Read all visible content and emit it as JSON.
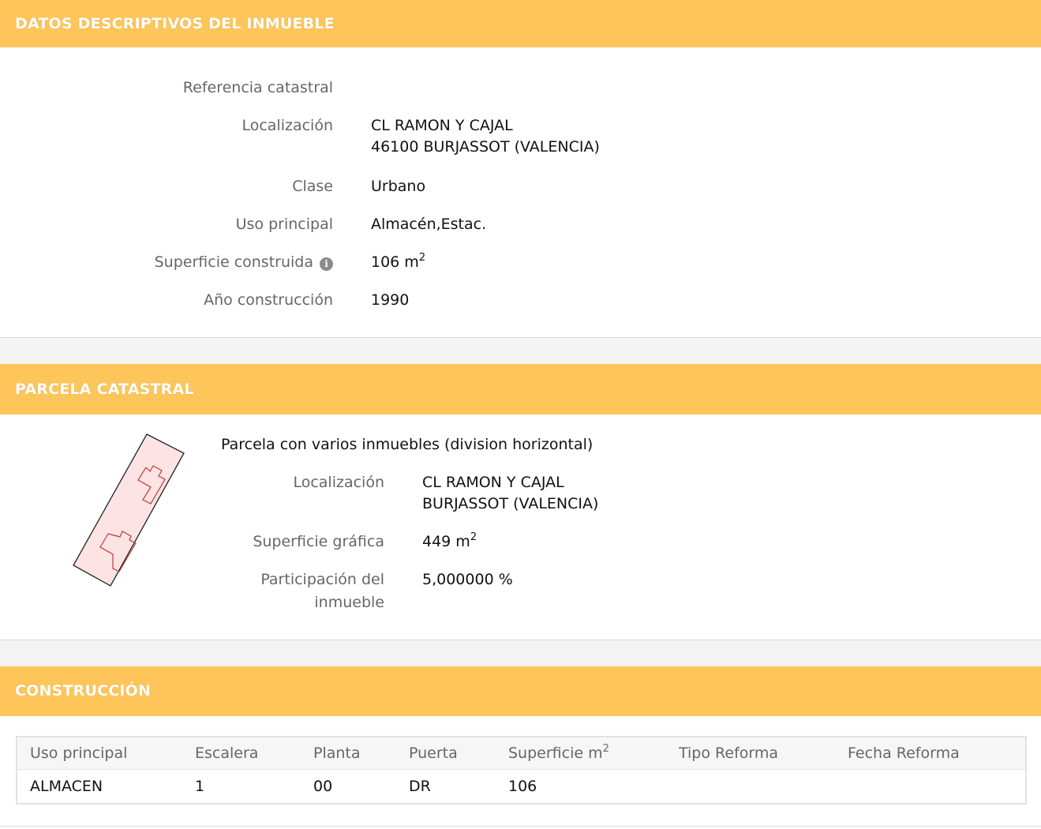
{
  "sections": {
    "descriptivos": {
      "title": "DATOS DESCRIPTIVOS DEL INMUEBLE"
    },
    "parcela": {
      "title": "PARCELA CATASTRAL"
    },
    "construccion": {
      "title": "CONSTRUCCIÓN"
    }
  },
  "inmueble": {
    "referencia_label": "Referencia catastral",
    "referencia_value": "",
    "localizacion_label": "Localización",
    "localizacion_line1": "CL RAMON Y CAJAL",
    "localizacion_line2": "46100 BURJASSOT (VALENCIA)",
    "clase_label": "Clase",
    "clase_value": "Urbano",
    "uso_label": "Uso principal",
    "uso_value": "Almacén,Estac.",
    "superficie_label": "Superficie construida",
    "superficie_value": "106 m",
    "superficie_unit_exp": "2",
    "anio_label": "Año construcción",
    "anio_value": "1990",
    "info_icon": "info-icon"
  },
  "parcela": {
    "heading": "Parcela con varios inmuebles (division horizontal)",
    "localizacion_label": "Localización",
    "localizacion_line1": "CL RAMON Y CAJAL",
    "localizacion_line2": "BURJASSOT (VALENCIA)",
    "superficie_label": "Superficie gráfica",
    "superficie_value": "449 m",
    "superficie_unit_exp": "2",
    "participacion_label_line1": "Participación del",
    "participacion_label_line2": "inmueble",
    "participacion_value": "5,000000 %"
  },
  "construccion": {
    "columns": [
      "Uso principal",
      "Escalera",
      "Planta",
      "Puerta",
      "Superficie m",
      "Tipo Reforma",
      "Fecha Reforma"
    ],
    "superficie_col_exp": "2",
    "rows": [
      [
        "ALMACEN",
        "1",
        "00",
        "DR",
        "106",
        "",
        ""
      ]
    ]
  },
  "colors": {
    "header_bg": "#fec65a",
    "parcel_fill": "#fde3e3",
    "parcel_stroke": "#222222",
    "building_stroke": "#c0393b"
  }
}
